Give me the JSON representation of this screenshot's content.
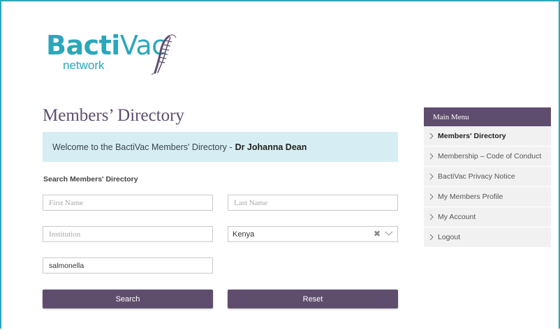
{
  "logo": {
    "name_part1": "Bacti",
    "name_part2": "Vac",
    "subtitle": "network",
    "brand_color": "#2aa7bb",
    "icon": "bacterium-icon"
  },
  "page": {
    "title": "Members’ Directory"
  },
  "welcome": {
    "text": "Welcome to the BactiVac Members' Directory -",
    "user_name": "Dr Johanna Dean"
  },
  "search": {
    "section_label": "Search Members' Directory",
    "first_name_placeholder": "First Name",
    "first_name_value": "",
    "last_name_placeholder": "Last Name",
    "last_name_value": "",
    "institution_placeholder": "Institution",
    "institution_value": "",
    "country_value": "Kenya",
    "keyword_value": "salmonella",
    "search_button": "Search",
    "reset_button": "Reset"
  },
  "main_menu": {
    "title": "Main Menu",
    "items": [
      {
        "label": "Members' Directory",
        "active": true
      },
      {
        "label": "Membership – Code of Conduct",
        "active": false
      },
      {
        "label": "BactiVac Privacy Notice",
        "active": false
      },
      {
        "label": "My Members Profile",
        "active": false
      },
      {
        "label": "My Account",
        "active": false
      },
      {
        "label": "Logout",
        "active": false
      }
    ]
  },
  "colors": {
    "accent": "#5f4d6e",
    "frame": "#2aa7bb",
    "welcome_bg": "#d6eef3",
    "menu_item_bg": "#f1f1f1"
  }
}
